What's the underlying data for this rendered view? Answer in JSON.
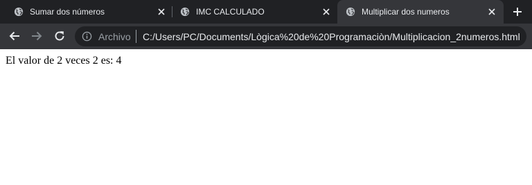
{
  "tabs": [
    {
      "title": "Sumar dos números",
      "icon": "globe-icon",
      "active": false
    },
    {
      "title": "IMC CALCULADO",
      "icon": "globe-icon",
      "active": false
    },
    {
      "title": "Multiplicar dos numeros",
      "icon": "globe-icon",
      "active": true
    }
  ],
  "toolbar": {
    "back_icon": "arrow-left-icon",
    "forward_icon": "arrow-right-icon",
    "reload_icon": "reload-icon"
  },
  "omnibox": {
    "security_label": "Archivo",
    "url": "C:/Users/PC/Documents/Lògica%20de%20Programaciòn/Multiplicacion_2numeros.html"
  },
  "page": {
    "text": "El valor de 2 veces 2 es: 4"
  },
  "colors": {
    "tabstrip_bg": "#202124",
    "toolbar_bg": "#35363a",
    "omnibox_bg": "#202124",
    "tab_text": "#e8eaed",
    "muted_text": "#9aa0a6",
    "page_bg": "#ffffff"
  }
}
